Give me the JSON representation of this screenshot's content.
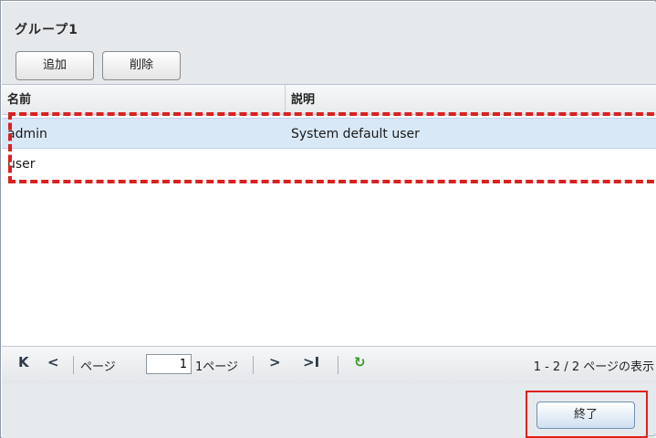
{
  "dialog": {
    "title": "グループ1",
    "toolbar": {
      "add_label": "追加",
      "delete_label": "削除"
    }
  },
  "grid": {
    "columns": [
      {
        "label": "名前"
      },
      {
        "label": "説明"
      }
    ],
    "rows": [
      {
        "name": "admin",
        "description": "System default user"
      },
      {
        "name": "user",
        "description": ""
      }
    ]
  },
  "pager": {
    "page_label": "ページ",
    "page_value": "1",
    "total_pages_label": "1ページ",
    "status": "1 - 2 / 2 ページの表示",
    "icons": [
      "first-page-icon",
      "previous-page-icon",
      "next-page-icon",
      "last-page-icon",
      "refresh-icon"
    ]
  },
  "footer": {
    "close_label": "終了"
  },
  "colors": {
    "annotation_red": "#e0211c",
    "selected_row": "#d9e8f7",
    "refresh_green": "#3b9a2c"
  }
}
